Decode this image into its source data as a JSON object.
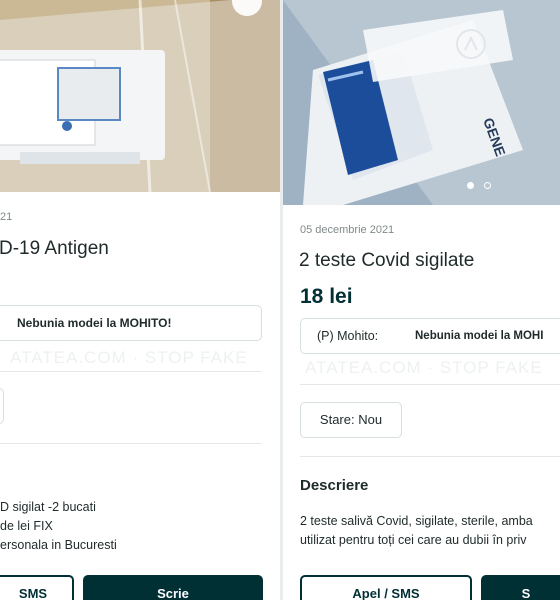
{
  "left": {
    "date": "21",
    "title": "D-19 Antigen",
    "seller_box": "Nebunia modei la MOHITO!",
    "description": [
      "D sigilat -2 bucati",
      "de lei FIX",
      "ersonala in Bucuresti"
    ],
    "call_button": "SMS",
    "write_button": "Scrie"
  },
  "right": {
    "date": "05 decembrie 2021",
    "title": "2 teste Covid sigilate",
    "price": "18 lei",
    "seller_label": "(P) Mohito:",
    "seller_name": "Nebunia modei la MOHI",
    "condition": "Stare: Nou",
    "description_heading": "Descriere",
    "description": [
      "2 teste salivă Covid, sigilate, sterile, amba",
      "utilizat pentru toți cei care au dubii în priv"
    ],
    "call_button": "Apel / SMS",
    "write_button": "S"
  }
}
